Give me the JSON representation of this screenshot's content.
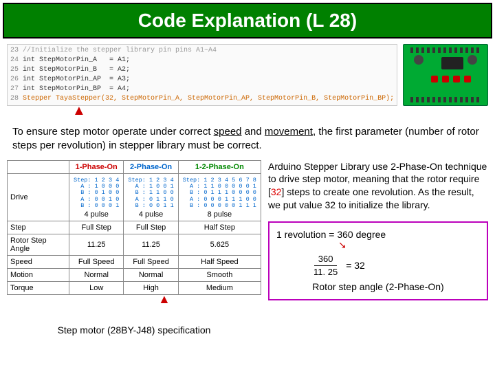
{
  "title": "Code Explanation (L 28)",
  "code": {
    "l23": "//Initialize the stepper library pin pins A1~A4",
    "l24": "int StepMotorPin_A   = A1;",
    "l25": "int StepMotorPin_B   = A2;",
    "l26": "int StepMotorPin_AP  = A3;",
    "l27": "int StepMotorPin_BP  = A4;",
    "l28": "Stepper TayaStepper(32, StepMotorPin_A, StepMotorPin_AP, StepMotorPin_B, StepMotorPin_BP);"
  },
  "explain_a": "To ensure step motor operate under correct ",
  "explain_speed": "speed",
  "explain_b": " and ",
  "explain_move": "movement",
  "explain_c": ", the first parameter (number of rotor steps per revolution) in stepper library must be correct.",
  "spec": {
    "headers": {
      "p1": "1-Phase-On",
      "p2": "2-Phase-On",
      "p12": "1-2-Phase-On"
    },
    "drive_label": "Drive",
    "seq1": "Step: 1 2 3 4\n  A : 1 0 0 0\n  B : 0 1 0 0\n  A : 0 0 1 0\n  B : 0 0 0 1",
    "seq2": "Step: 1 2 3 4\n  A : 1 0 0 1\n  B : 1 1 0 0\n  A : 0 1 1 0\n  B : 0 0 1 1",
    "seq12": "Step: 1 2 3 4 5 6 7 8\n  A : 1 1 0 0 0 0 0 1\n  B : 0 1 1 1 0 0 0 0\n  A : 0 0 0 1 1 1 0 0\n  B : 0 0 0 0 0 1 1 1",
    "pulse1": "4 pulse",
    "pulse2": "4 pulse",
    "pulse12": "8 pulse",
    "rows": [
      {
        "h": "Step",
        "c1": "Full Step",
        "c2": "Full Step",
        "c3": "Half Step"
      },
      {
        "h": "Rotor Step Angle",
        "c1": "11.25",
        "c2": "11.25",
        "c3": "5.625"
      },
      {
        "h": "Speed",
        "c1": "Full Speed",
        "c2": "Full Speed",
        "c3": "Half Speed"
      },
      {
        "h": "Motion",
        "c1": "Normal",
        "c2": "Normal",
        "c3": "Smooth"
      },
      {
        "h": "Torque",
        "c1": "Low",
        "c2": "High",
        "c3": "Medium"
      }
    ],
    "caption": "Step motor (28BY-J48) specification"
  },
  "right": {
    "p_a": "Arduino Stepper Library use 2-Phase-On technique to drive step motor, meaning that the rotor require [",
    "p_32": "32",
    "p_b": "] steps to create one revolution.  As the result, we put value 32 to initialize the library."
  },
  "calc": {
    "rev": "1 revolution = 360 degree",
    "num": "360",
    "den": "11. 25",
    "eq": "= 32",
    "caption": "Rotor step angle (2-Phase-On)"
  }
}
